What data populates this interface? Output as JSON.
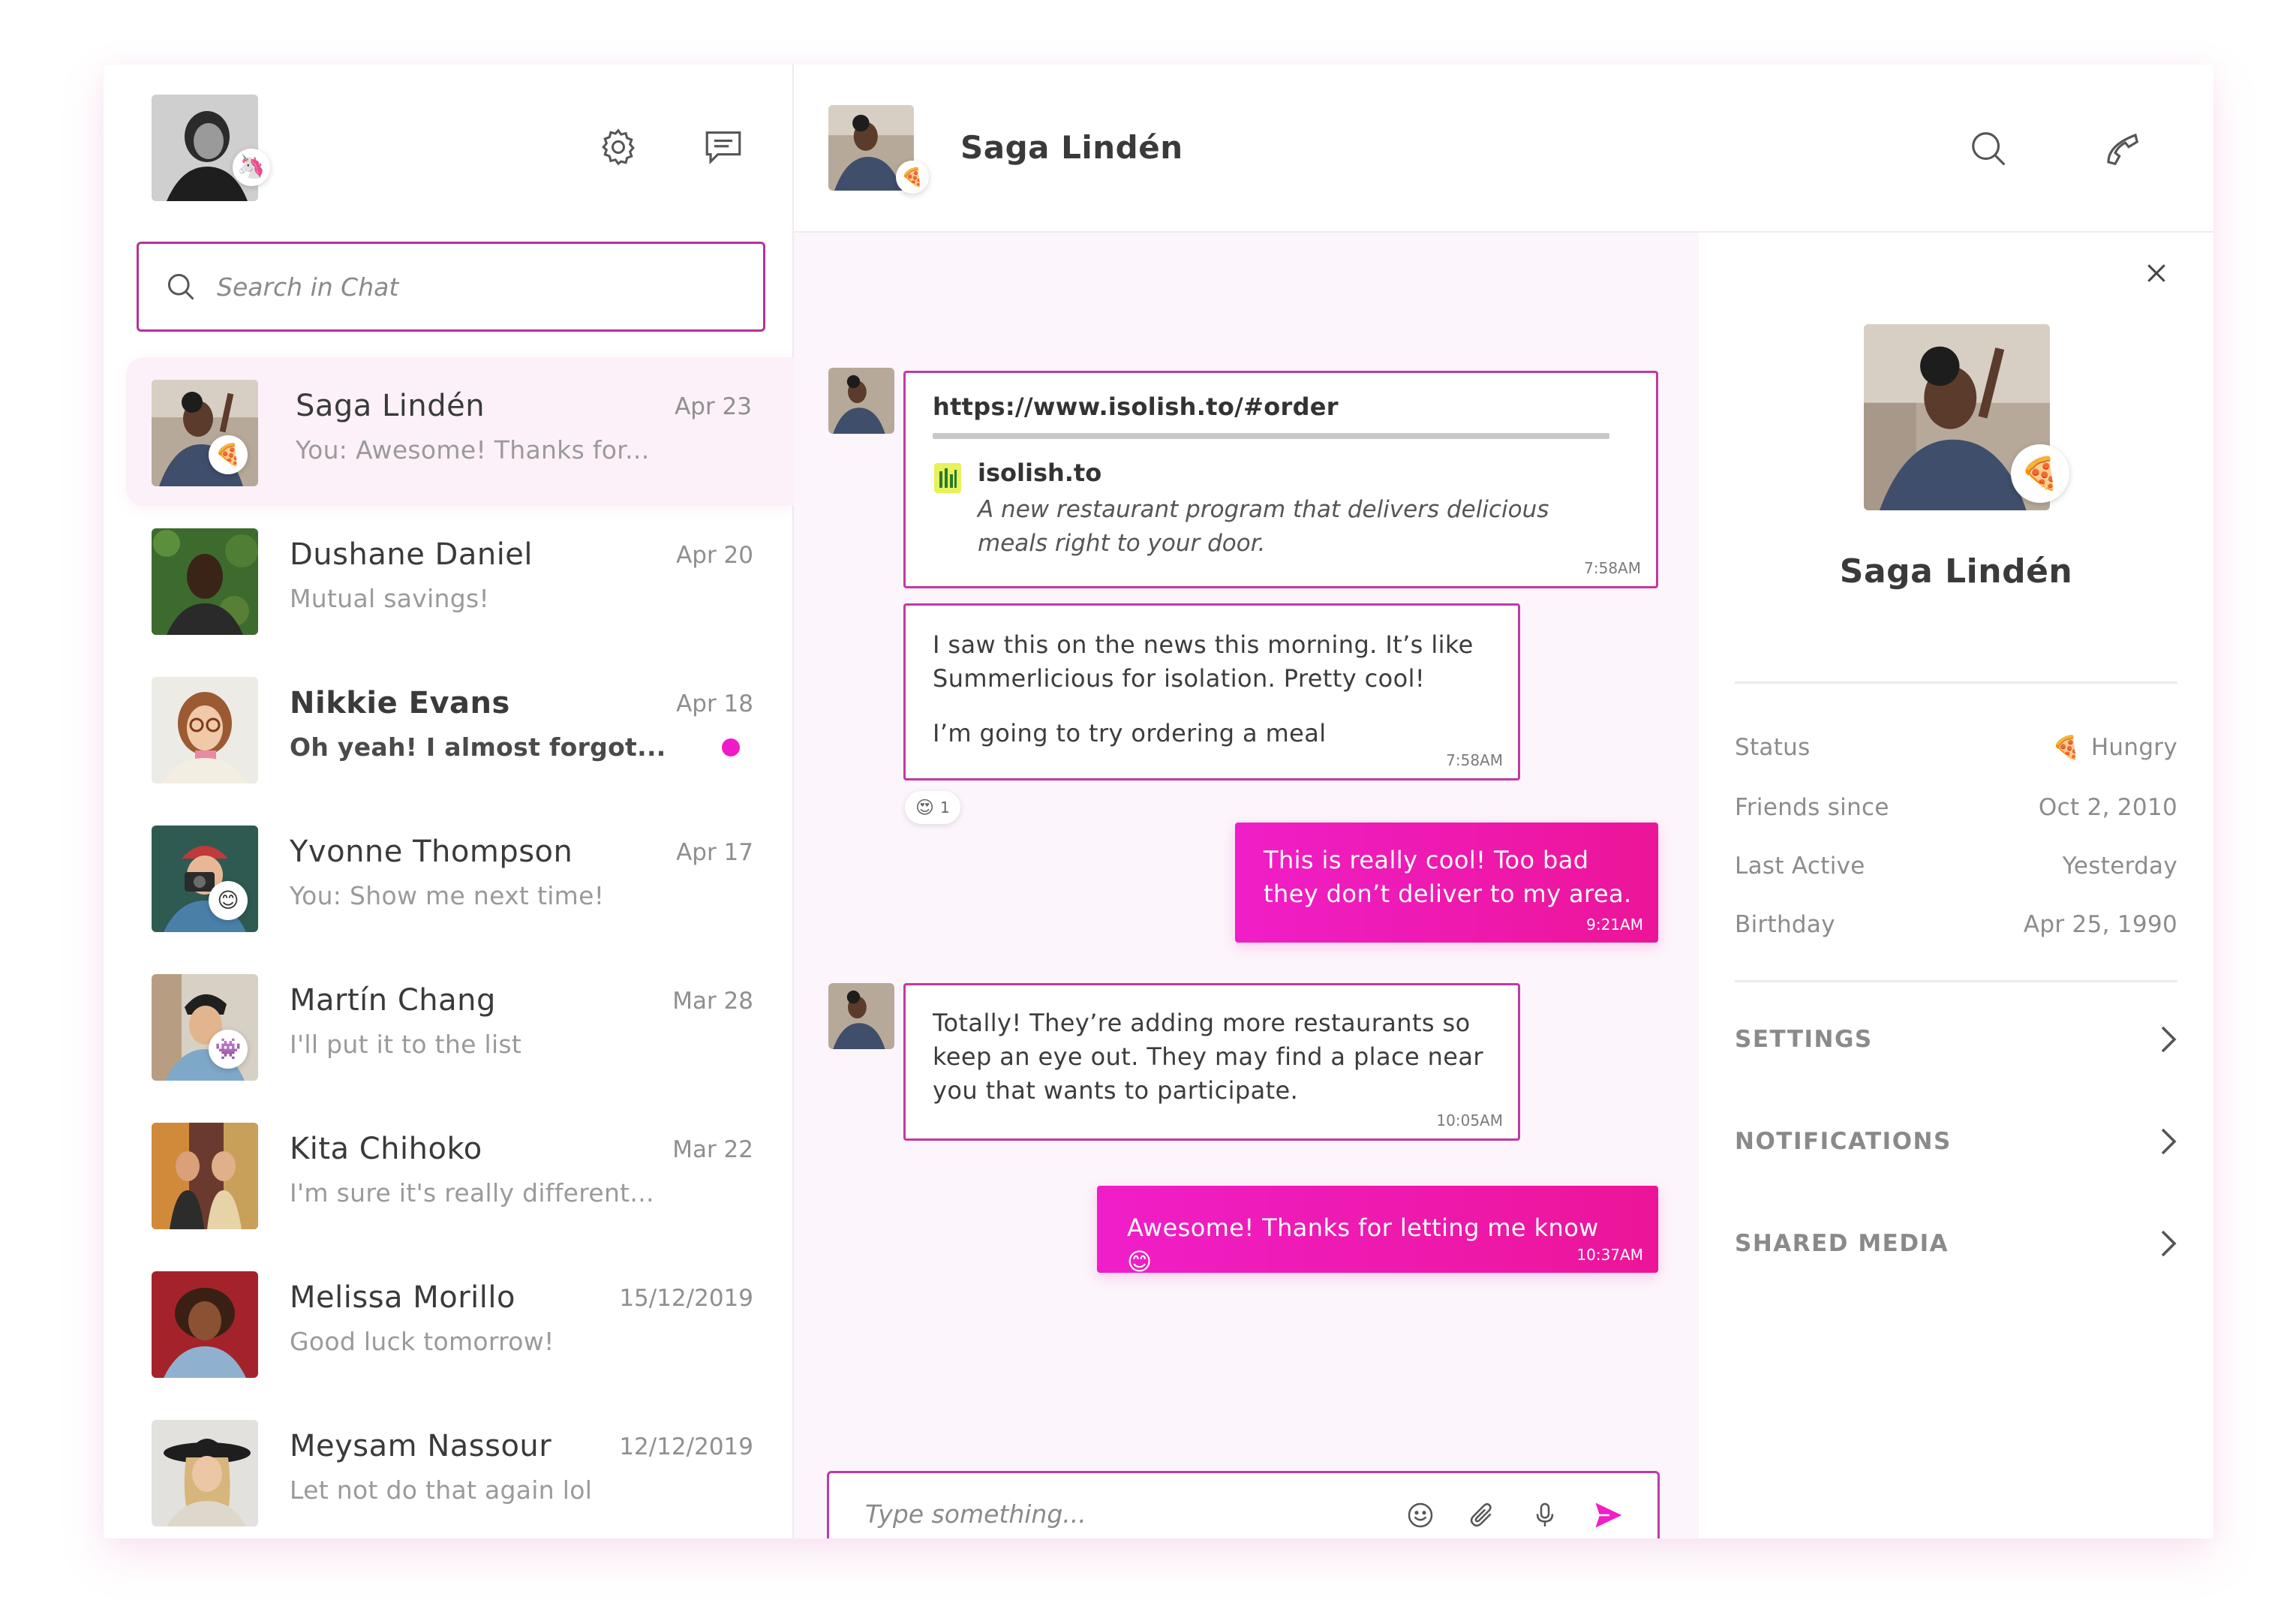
{
  "me": {
    "avatar_label": "Profile photo",
    "status_emoji": "🦄"
  },
  "search": {
    "placeholder": "Search in Chat"
  },
  "conversations": [
    {
      "name": "Saga Lindén",
      "preview": "You: Awesome! Thanks for...",
      "date": "Apr 23",
      "status_emoji": "🍕",
      "unread": false,
      "active": true
    },
    {
      "name": "Dushane Daniel",
      "preview": "Mutual savings!",
      "date": "Apr 20",
      "status_emoji": "",
      "unread": false,
      "active": false
    },
    {
      "name": "Nikkie Evans",
      "preview": "Oh yeah! I almost forgot...",
      "date": "Apr 18",
      "status_emoji": "",
      "unread": true,
      "active": false
    },
    {
      "name": "Yvonne Thompson",
      "preview": "You: Show me next time!",
      "date": "Apr 17",
      "status_emoji": "😊",
      "unread": false,
      "active": false
    },
    {
      "name": "Martín Chang",
      "preview": "I'll put it to the list",
      "date": "Mar 28",
      "status_emoji": "👾",
      "unread": false,
      "active": false
    },
    {
      "name": "Kita Chihoko",
      "preview": "I'm sure it's really different...",
      "date": "Mar 22",
      "status_emoji": "",
      "unread": false,
      "active": false
    },
    {
      "name": "Melissa Morillo",
      "preview": "Good luck tomorrow!",
      "date": "15/12/2019",
      "status_emoji": "",
      "unread": false,
      "active": false
    },
    {
      "name": "Meysam Nassour",
      "preview": "Let not do that again lol",
      "date": "12/12/2019",
      "status_emoji": "",
      "unread": false,
      "active": false
    }
  ],
  "header": {
    "name": "Saga Lindén",
    "status_emoji": "🍕"
  },
  "messages": {
    "link": {
      "url": "https://www.isolish.to/#order",
      "site": "isolish.to",
      "description": "A new restaurant program that delivers delicious meals right to your door.",
      "time": "7:58AM"
    },
    "m1": {
      "line1": "I saw this on the news this morning. It’s like Summerlicious for isolation. Pretty cool!",
      "line2": "I’m going to try ordering a meal",
      "time": "7:58AM",
      "reaction_emoji": "😍",
      "reaction_count": "1"
    },
    "m2": {
      "text": "This is really cool! Too bad they don’t deliver to my area.",
      "time": "9:21AM"
    },
    "m3": {
      "text": "Totally! They’re adding more restaurants so keep an eye out. They may find a place near you that wants to participate.",
      "time": "10:05AM"
    },
    "m4": {
      "text": "Awesome! Thanks for letting me know 😊",
      "time": "10:37AM"
    }
  },
  "composer": {
    "placeholder": "Type something..."
  },
  "profile": {
    "name": "Saga Lindén",
    "status_emoji": "🍕",
    "info": [
      {
        "label": "Status",
        "value": "Hungry",
        "emoji": "🍕"
      },
      {
        "label": "Friends since",
        "value": "Oct 2, 2010"
      },
      {
        "label": "Last Active",
        "value": "Yesterday"
      },
      {
        "label": "Birthday",
        "value": "Apr 25, 1990"
      }
    ],
    "sections": [
      "SETTINGS",
      "NOTIFICATIONS",
      "SHARED MEDIA"
    ]
  },
  "colors": {
    "accent": "#f01ec8",
    "accent_dark": "#c03aa5",
    "chat_bg": "#fcf5fb"
  }
}
